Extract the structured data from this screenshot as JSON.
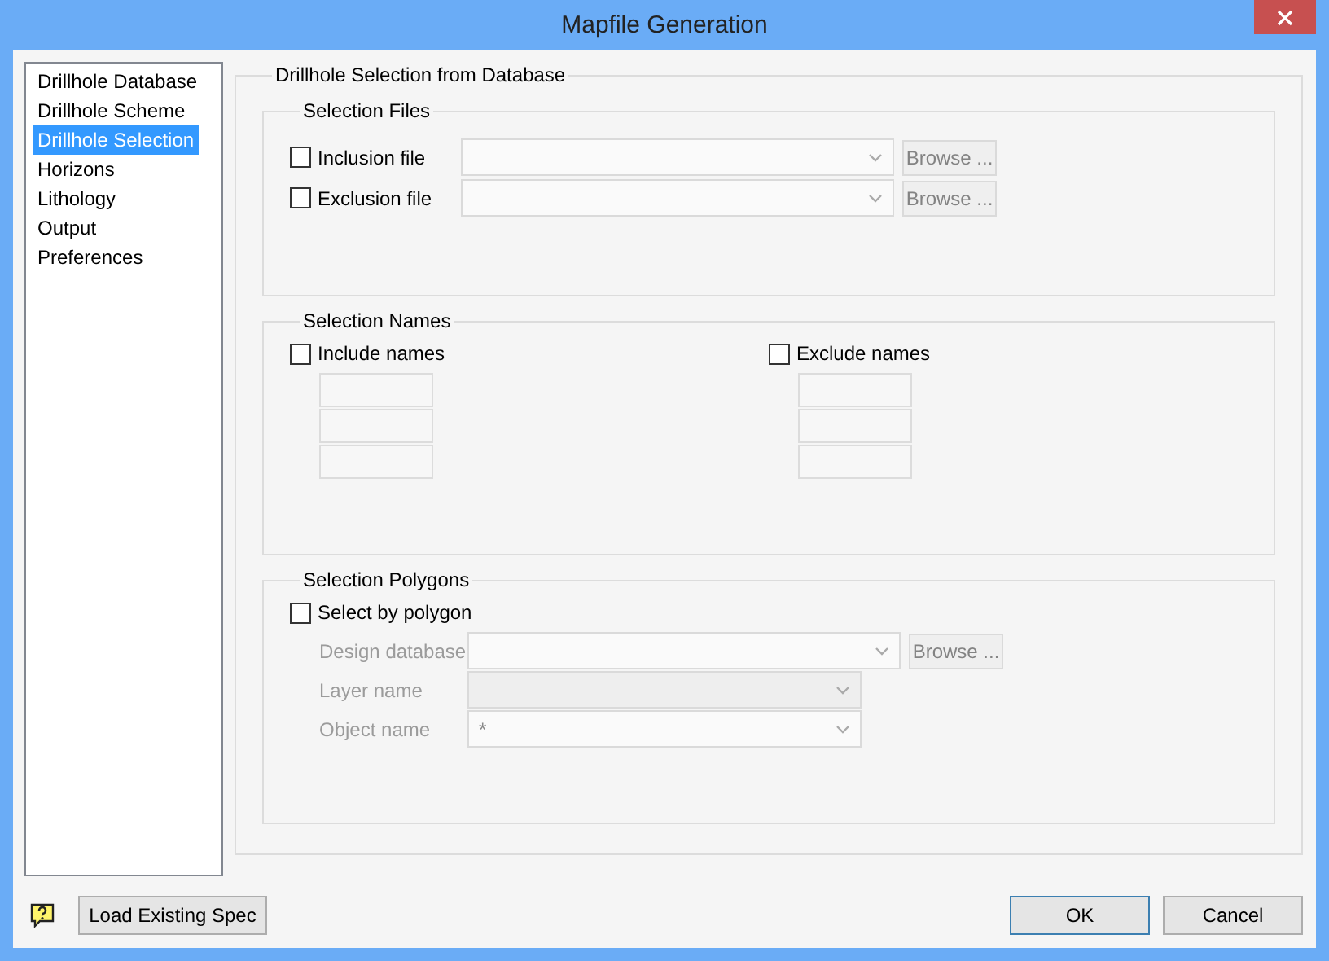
{
  "window": {
    "title": "Mapfile Generation"
  },
  "nav": {
    "items": [
      {
        "label": "Drillhole Database",
        "selected": false
      },
      {
        "label": "Drillhole Scheme",
        "selected": false
      },
      {
        "label": "Drillhole Selection",
        "selected": true
      },
      {
        "label": "Horizons",
        "selected": false
      },
      {
        "label": "Lithology",
        "selected": false
      },
      {
        "label": "Output",
        "selected": false
      },
      {
        "label": "Preferences",
        "selected": false
      }
    ]
  },
  "panel": {
    "title": "Drillhole Selection from Database",
    "groups": [
      {
        "kind": "files",
        "title": "Selection Files",
        "rows": [
          {
            "label": "Inclusion file",
            "checked": false,
            "browse": "Browse ...",
            "disabled": true
          },
          {
            "label": "Exclusion file",
            "checked": false,
            "browse": "Browse ...",
            "disabled": true
          }
        ]
      },
      {
        "kind": "names",
        "title": "Selection Names",
        "lists": [
          {
            "label": "Include names",
            "checked": false
          },
          {
            "label": "Exclude names",
            "checked": false
          }
        ]
      },
      {
        "kind": "polygons",
        "title": "Selection Polygons",
        "checkbox": {
          "label": "Select by polygon",
          "checked": false
        },
        "fields": [
          {
            "kind": "combo",
            "label": "Design database",
            "disabled": true,
            "browse": "Browse ..."
          },
          {
            "kind": "list",
            "label": "Layer name",
            "disabled": true
          },
          {
            "kind": "combo",
            "label": "Object name",
            "disabled": true,
            "value": "*"
          }
        ]
      }
    ]
  },
  "footer": {
    "load_button": "Load Existing Spec",
    "buttons": [
      {
        "label": "OK",
        "default": true
      },
      {
        "label": "Cancel",
        "default": false
      }
    ]
  }
}
